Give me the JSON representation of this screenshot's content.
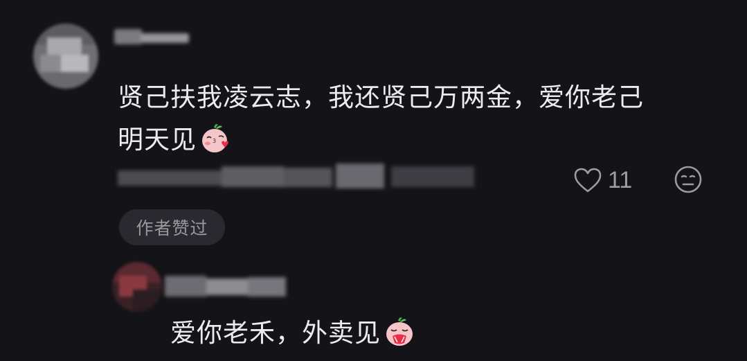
{
  "comment": {
    "text_line1": "贤己扶我凌云志，我还贤己万两金，爱你老己",
    "text_line2": "明天见",
    "emoji": "kiss-face-emoji",
    "likes": "11",
    "author_badge": "作者赞过"
  },
  "reply": {
    "text": "爱你老禾，外卖见",
    "emoji": "pleading-face-emoji"
  },
  "colors": {
    "background": "#141318",
    "text": "#ececf0",
    "muted": "#9d9ca3",
    "badge_bg": "#2a292f",
    "emoji_pink": "#f4a7ae",
    "emoji_green": "#4caf50"
  }
}
